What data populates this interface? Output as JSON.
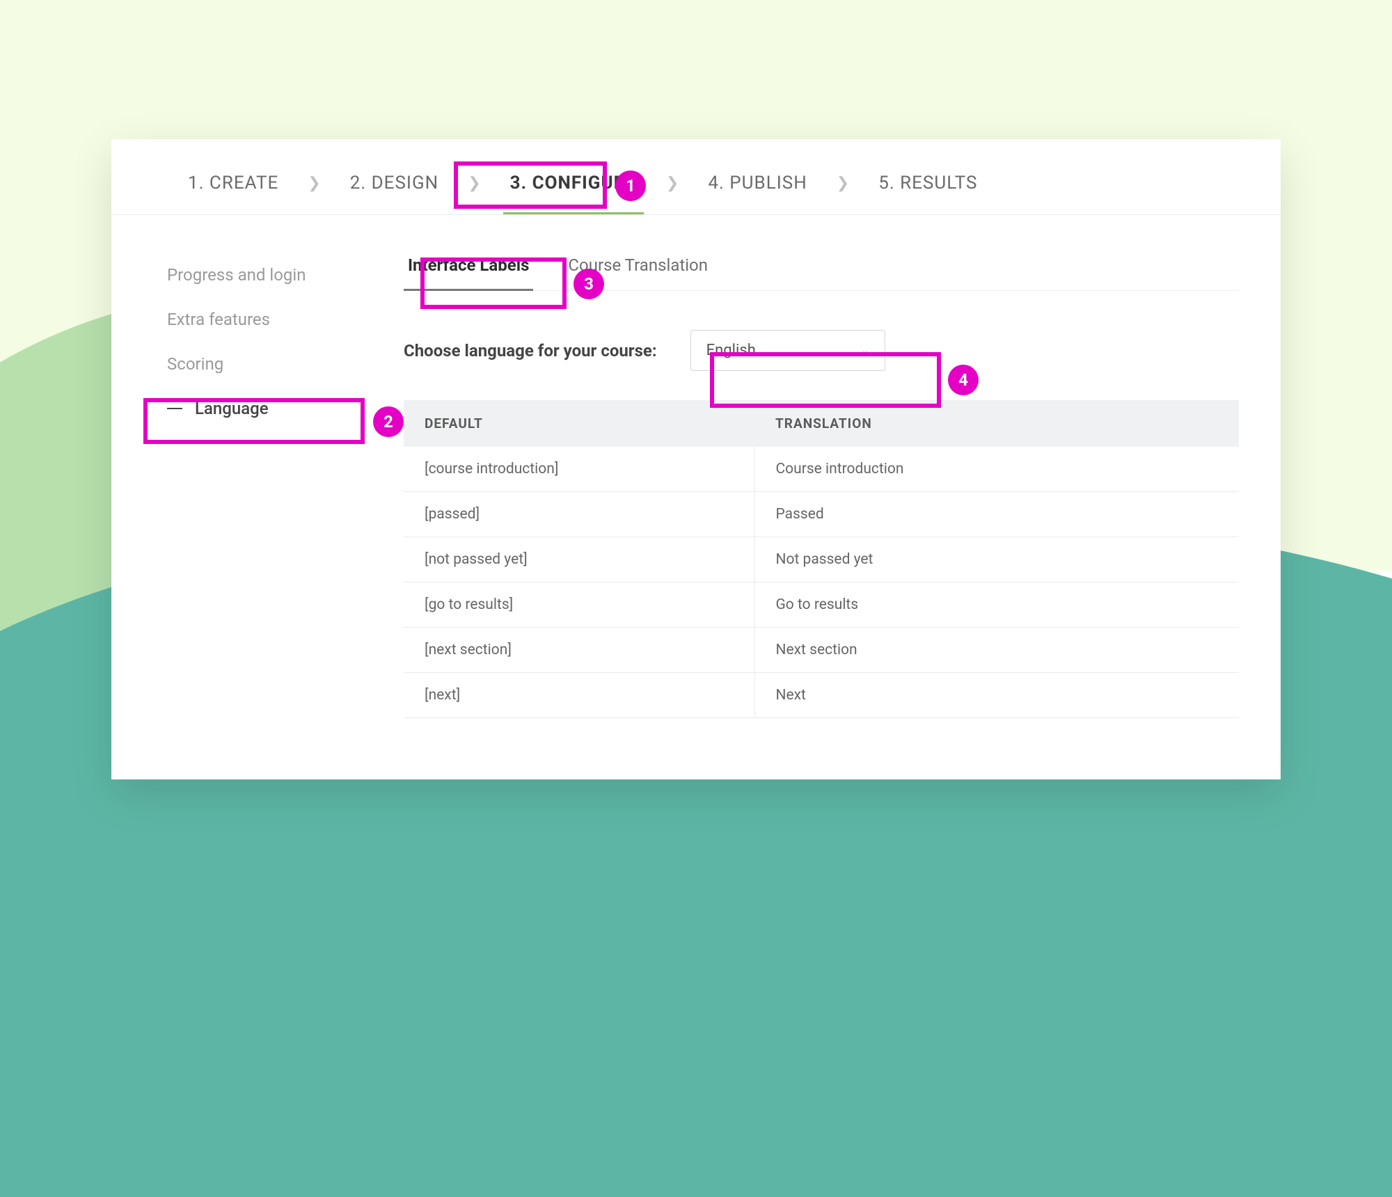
{
  "steps": [
    {
      "label": "1. CREATE"
    },
    {
      "label": "2. DESIGN"
    },
    {
      "label": "3. CONFIGURE",
      "active": true
    },
    {
      "label": "4. PUBLISH"
    },
    {
      "label": "5. RESULTS"
    }
  ],
  "sidebar": {
    "items": [
      {
        "label": "Progress and login"
      },
      {
        "label": "Extra features"
      },
      {
        "label": "Scoring"
      },
      {
        "label": "Language",
        "active": true
      }
    ]
  },
  "tabs": [
    {
      "label": "Interface Labels",
      "active": true
    },
    {
      "label": "Course Translation"
    }
  ],
  "language_prompt": "Choose language for your course:",
  "language_select": {
    "value": "English"
  },
  "table": {
    "headers": {
      "default": "DEFAULT",
      "translation": "TRANSLATION"
    },
    "rows": [
      {
        "default": "[course introduction]",
        "translation": "Course introduction"
      },
      {
        "default": "[passed]",
        "translation": "Passed"
      },
      {
        "default": "[not passed yet]",
        "translation": "Not passed yet"
      },
      {
        "default": "[go to results]",
        "translation": "Go to results"
      },
      {
        "default": "[next section]",
        "translation": "Next section"
      },
      {
        "default": "[next]",
        "translation": "Next"
      }
    ]
  },
  "annotations": {
    "badge1": "1",
    "badge2": "2",
    "badge3": "3",
    "badge4": "4"
  }
}
